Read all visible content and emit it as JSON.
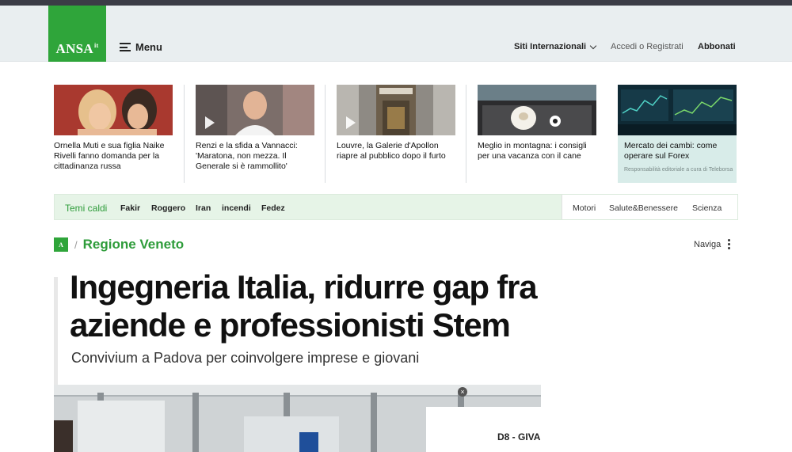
{
  "header": {
    "logo_text": "ANSA",
    "logo_sup": "it",
    "menu_label": "Menu",
    "siti_label": "Siti Internazionali",
    "accedi_label": "Accedi o Registrati",
    "abbonati_label": "Abbonati"
  },
  "cards": [
    {
      "title": "Ornella Muti e sua figlia Naike Rivelli fanno domanda per la cittadinanza russa",
      "video": false
    },
    {
      "title": "Renzi e la sfida a Vannacci: 'Maratona, non mezza. Il Generale si è rammollito'",
      "video": true
    },
    {
      "title": "Louvre, la Galerie d'Apollon riapre al pubblico dopo il furto",
      "video": true
    },
    {
      "title": "Meglio in montagna: i consigli per una vacanza con il cane",
      "video": false
    },
    {
      "title": "Mercato dei cambi: come operare sul Forex",
      "note": "Responsabilità editoriale a cura di Teleborsa",
      "sponsored": true
    }
  ],
  "topics": {
    "hot_label": "Temi caldi",
    "items": [
      "Fakir",
      "Roggero",
      "Iran",
      "incendi",
      "Fedez"
    ],
    "right_items": [
      "Motori",
      "Salute&Benessere",
      "Scienza"
    ]
  },
  "section": {
    "logo": "A",
    "title": "Regione Veneto",
    "naviga_label": "Naviga"
  },
  "article": {
    "headline": "Ingegneria Italia, ridurre gap fra aziende e professionisti Stem",
    "subhead": "Convivium a Padova per coinvolgere imprese e giovani",
    "photo_sign": "D8 - GIVA"
  },
  "colors": {
    "brand_green": "#2fa53a",
    "header_bg": "#e9eef0",
    "topics_bg": "#e6f4e7",
    "sponsored_bg": "#d8ece9"
  }
}
